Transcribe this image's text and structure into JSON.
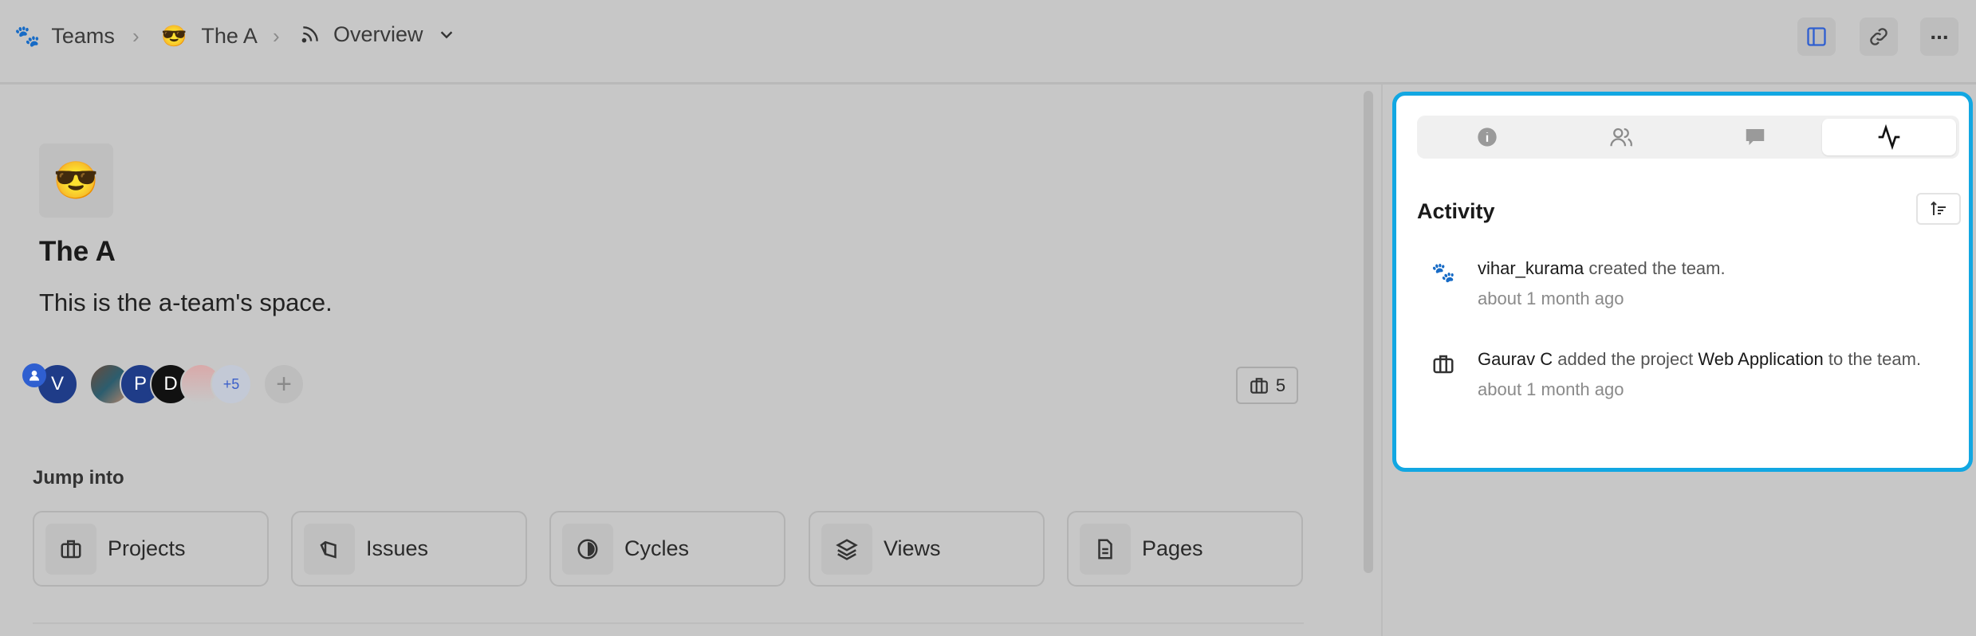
{
  "breadcrumb": {
    "teams": "Teams",
    "team_emoji": "😎",
    "team": "The A",
    "current": "Overview"
  },
  "header_actions": [
    "sidebar-toggle",
    "copy-link",
    "more-options"
  ],
  "team": {
    "emoji": "😎",
    "name": "The A",
    "description": "This is the a-team's space."
  },
  "members": {
    "avatars": [
      "V",
      "",
      "P",
      "D",
      ""
    ],
    "overflow": "+5",
    "colors": {
      "v": "#1f3c88",
      "p": "#1f3c88",
      "d": "#111111",
      "overflow": "#c9ced8"
    }
  },
  "projects_count": "5",
  "jump_into": {
    "heading": "Jump into",
    "items": [
      {
        "label": "Projects",
        "icon": "briefcase-icon"
      },
      {
        "label": "Issues",
        "icon": "issues-icon"
      },
      {
        "label": "Cycles",
        "icon": "cycle-icon"
      },
      {
        "label": "Views",
        "icon": "layers-icon"
      },
      {
        "label": "Pages",
        "icon": "page-icon"
      }
    ]
  },
  "panel": {
    "tabs": [
      {
        "icon": "info-icon"
      },
      {
        "icon": "members-icon"
      },
      {
        "icon": "comment-icon"
      },
      {
        "icon": "activity-icon",
        "active": true
      }
    ],
    "heading": "Activity",
    "items": [
      {
        "actor": "vihar_kurama",
        "text": " created the team.",
        "time": "about 1 month ago"
      },
      {
        "actor": "Gaurav C",
        "text": " added the project ",
        "target": "Web Application",
        "tail": " to the team.",
        "time": "about 1 month ago"
      }
    ],
    "accent": "#12a7e2"
  }
}
